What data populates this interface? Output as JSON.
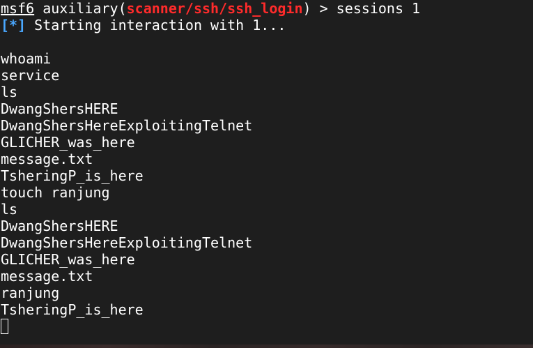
{
  "prompt": {
    "name": "msf6",
    "context_prefix": " auxiliary(",
    "module": "scanner/ssh/ssh_login",
    "context_suffix": ") > ",
    "command": "sessions 1"
  },
  "status": {
    "tag": "[*]",
    "message": " Starting interaction with 1..."
  },
  "output_lines": [
    "",
    "whoami",
    "service",
    "ls",
    "DwangShersHERE",
    "DwangShersHereExploitingTelnet",
    "GLICHER_was_here",
    "message.txt",
    "TsheringP_is_here",
    "touch ranjung",
    "ls",
    "DwangShersHERE",
    "DwangShersHereExploitingTelnet",
    "GLICHER_was_here",
    "message.txt",
    "ranjung",
    "TsheringP_is_here"
  ],
  "colors": {
    "background": "#1e1e1e",
    "text": "#ffffff",
    "module": "#ff2b2b",
    "status_tag": "#4aa8ff"
  }
}
